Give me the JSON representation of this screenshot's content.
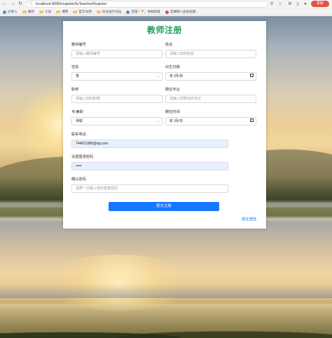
{
  "browser": {
    "url": "localhost:8080/register/toTeacherRegister",
    "update_label": "更新",
    "bookmarks": [
      "已导入",
      "我的",
      "工具",
      "博客",
      "官方文档",
      "毕业设计论坛",
      "百度一下，你就知道",
      "互联网人副业指南..."
    ]
  },
  "form": {
    "title": "教师注册",
    "fields": {
      "teacher_id": {
        "label": "教师编号",
        "placeholder": "请输入教师编号"
      },
      "name": {
        "label": "姓名",
        "placeholder": "请输入您的姓名"
      },
      "gender": {
        "label": "性别",
        "value": "男"
      },
      "birthdate": {
        "label": "出生日期",
        "placeholder": "年 /月/日"
      },
      "title_rank": {
        "label": "职称",
        "placeholder": "请输入您的职称"
      },
      "major": {
        "label": "聘任专业",
        "placeholder": "请输入您聘任的专业"
      },
      "employment": {
        "label": "专/兼职",
        "value": "专职"
      },
      "hire_date": {
        "label": "聘任时间",
        "placeholder": "年 /月/日"
      },
      "phone": {
        "label": "联系电话",
        "value": "744621980@qq.com"
      },
      "password": {
        "label": "设置登录密码",
        "value": "•••••"
      },
      "confirm": {
        "label": "确认密码",
        "placeholder": "请再一次输入您的登录密码"
      }
    },
    "submit_label": "提交注册",
    "login_link": "前往登陆"
  },
  "colors": {
    "title": "#1e9e5a",
    "primary": "#1677ff",
    "autofill": "#e8f0fd",
    "update": "#e0533f"
  }
}
